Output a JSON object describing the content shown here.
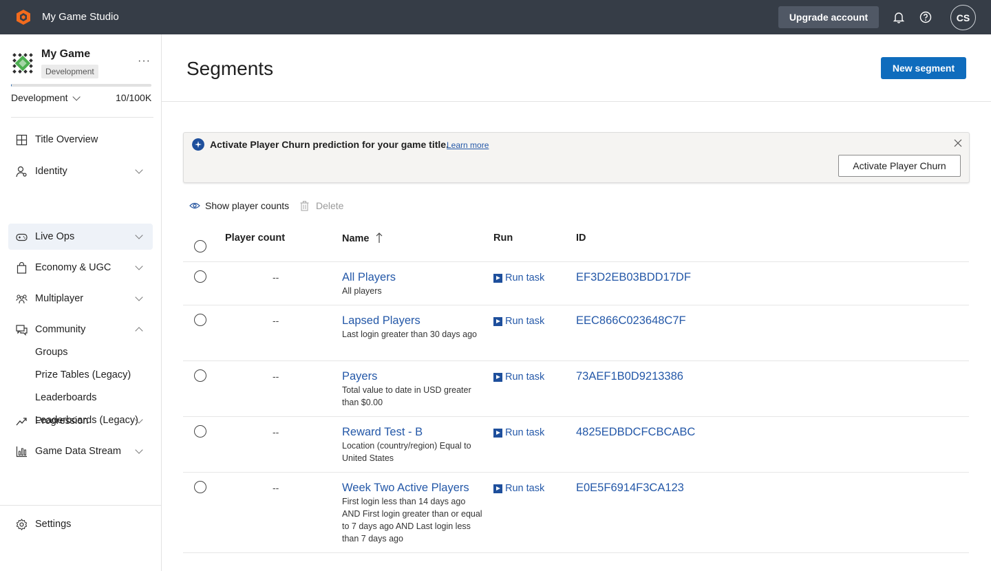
{
  "topbar": {
    "studio_name": "My Game Studio",
    "upgrade_label": "Upgrade account",
    "avatar_initials": "CS"
  },
  "sidebar": {
    "game_name": "My Game",
    "environment_badge": "Development",
    "environment_select": "Development",
    "usage_count": "10/100K",
    "usage_fraction": 0.0001,
    "nav": [
      {
        "label": "Title Overview",
        "icon": "grid-icon"
      },
      {
        "label": "Identity",
        "icon": "identity-icon"
      },
      {
        "label": "Live Ops",
        "icon": "gamepad-icon"
      },
      {
        "label": "Economy & UGC",
        "icon": "shopping-bag-icon"
      },
      {
        "label": "Multiplayer",
        "icon": "people-icon"
      },
      {
        "label": "Community",
        "icon": "chat-icon"
      },
      {
        "label": "Progression",
        "icon": "trend-icon"
      },
      {
        "label": "Game Data Stream",
        "icon": "bar-chart-icon"
      }
    ],
    "community_sub": [
      "Groups",
      "Prize Tables (Legacy)",
      "Leaderboards",
      "Leaderboards (Legacy)"
    ],
    "settings_label": "Settings"
  },
  "main": {
    "title": "Segments",
    "new_segment_label": "New segment",
    "banner": {
      "text": "Activate Player Churn prediction for your game title.",
      "link": "Learn more",
      "button": "Activate Player Churn"
    },
    "toolbar": {
      "show_counts": "Show player counts",
      "delete": "Delete"
    },
    "table": {
      "headers": {
        "count": "Player count",
        "name": "Name",
        "run": "Run",
        "id": "ID"
      },
      "run_label": "Run task",
      "rows": [
        {
          "count": "--",
          "name": "All Players",
          "desc": "All players",
          "id": "EF3D2EB03BDD17DF"
        },
        {
          "count": "--",
          "name": "Lapsed Players",
          "desc": "Last login greater than 30 days ago",
          "id": "EEC866C023648C7F"
        },
        {
          "count": "--",
          "name": "Payers",
          "desc": "Total value to date in USD greater than $0.00",
          "id": "73AEF1B0D9213386"
        },
        {
          "count": "--",
          "name": "Reward Test - B",
          "desc": "Location (country/region) Equal to United States",
          "id": "4825EDBDCFCBCABC"
        },
        {
          "count": "--",
          "name": "Week Two Active Players",
          "desc": "First login less than 14 days ago AND First login greater than or equal to 7 days ago AND Last login less than 7 days ago",
          "id": "E0E5F6914F3CA123"
        }
      ]
    }
  }
}
